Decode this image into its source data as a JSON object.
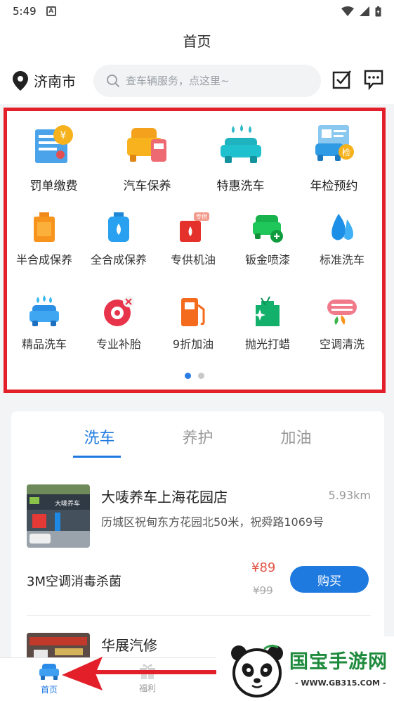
{
  "status_bar": {
    "time": "5:49",
    "notif_letter": "A"
  },
  "header": {
    "title": "首页"
  },
  "location": {
    "city": "济南市"
  },
  "search": {
    "placeholder": "查车辆服务，点这里~"
  },
  "services_row1": [
    {
      "label": "罚单缴费",
      "icon": "ticket-icon"
    },
    {
      "label": "汽车保养",
      "icon": "car-maintenance-icon"
    },
    {
      "label": "特惠洗车",
      "icon": "car-wash-icon"
    },
    {
      "label": "年检预约",
      "icon": "inspection-icon"
    }
  ],
  "services_row2": [
    {
      "label": "半合成保养",
      "icon": "oil-can-orange-icon"
    },
    {
      "label": "全合成保养",
      "icon": "oil-bottle-blue-icon"
    },
    {
      "label": "专供机油",
      "icon": "oil-can-red-icon",
      "badge": "专供"
    },
    {
      "label": "钣金喷漆",
      "icon": "spray-paint-icon"
    },
    {
      "label": "标准洗车",
      "icon": "water-drop-icon"
    }
  ],
  "services_row3": [
    {
      "label": "精品洗车",
      "icon": "premium-wash-icon"
    },
    {
      "label": "专业补胎",
      "icon": "tire-repair-icon"
    },
    {
      "label": "9折加油",
      "icon": "fuel-pump-icon"
    },
    {
      "label": "抛光打蜡",
      "icon": "polish-wax-icon"
    },
    {
      "label": "空调清洗",
      "icon": "ac-clean-icon"
    }
  ],
  "tabs": [
    {
      "label": "洗车",
      "active": true
    },
    {
      "label": "养护",
      "active": false
    },
    {
      "label": "加油",
      "active": false
    }
  ],
  "shop1": {
    "name": "大唛养车上海花园店",
    "distance": "5.93km",
    "address": "历城区祝甸东方花园北50米，祝舜路1069号",
    "sign_text": "大唛养车"
  },
  "deal": {
    "name": "3M空调消毒杀菌",
    "price": "¥89",
    "original_price": "¥99",
    "buy_label": "购买"
  },
  "shop2": {
    "name": "华展汽修"
  },
  "tabbar": [
    {
      "label": "首页",
      "icon": "car-home-icon",
      "active": true
    },
    {
      "label": "福利",
      "icon": "gift-icon",
      "active": false
    }
  ],
  "watermark": {
    "brand": "国宝手游网",
    "url": "- WWW.GB315.COM -"
  },
  "colors": {
    "accent": "#1f7ae0",
    "highlight_border": "#e3202a",
    "price": "#e05545"
  }
}
